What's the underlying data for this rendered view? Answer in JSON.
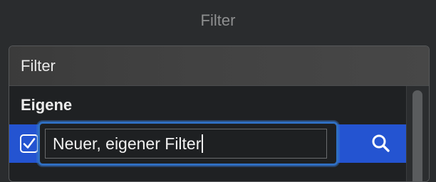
{
  "window": {
    "title": "Filter"
  },
  "panel": {
    "header": "Filter",
    "section_title": "Eigene",
    "rows": [
      {
        "checked": true,
        "name": "Neuer, eigener Filter",
        "editing": true
      }
    ]
  },
  "icons": {
    "checkbox": "checkmark-icon",
    "search": "magnifier-icon"
  },
  "colors": {
    "selection": "#2454d1",
    "edit_border": "#2f6fc2"
  }
}
